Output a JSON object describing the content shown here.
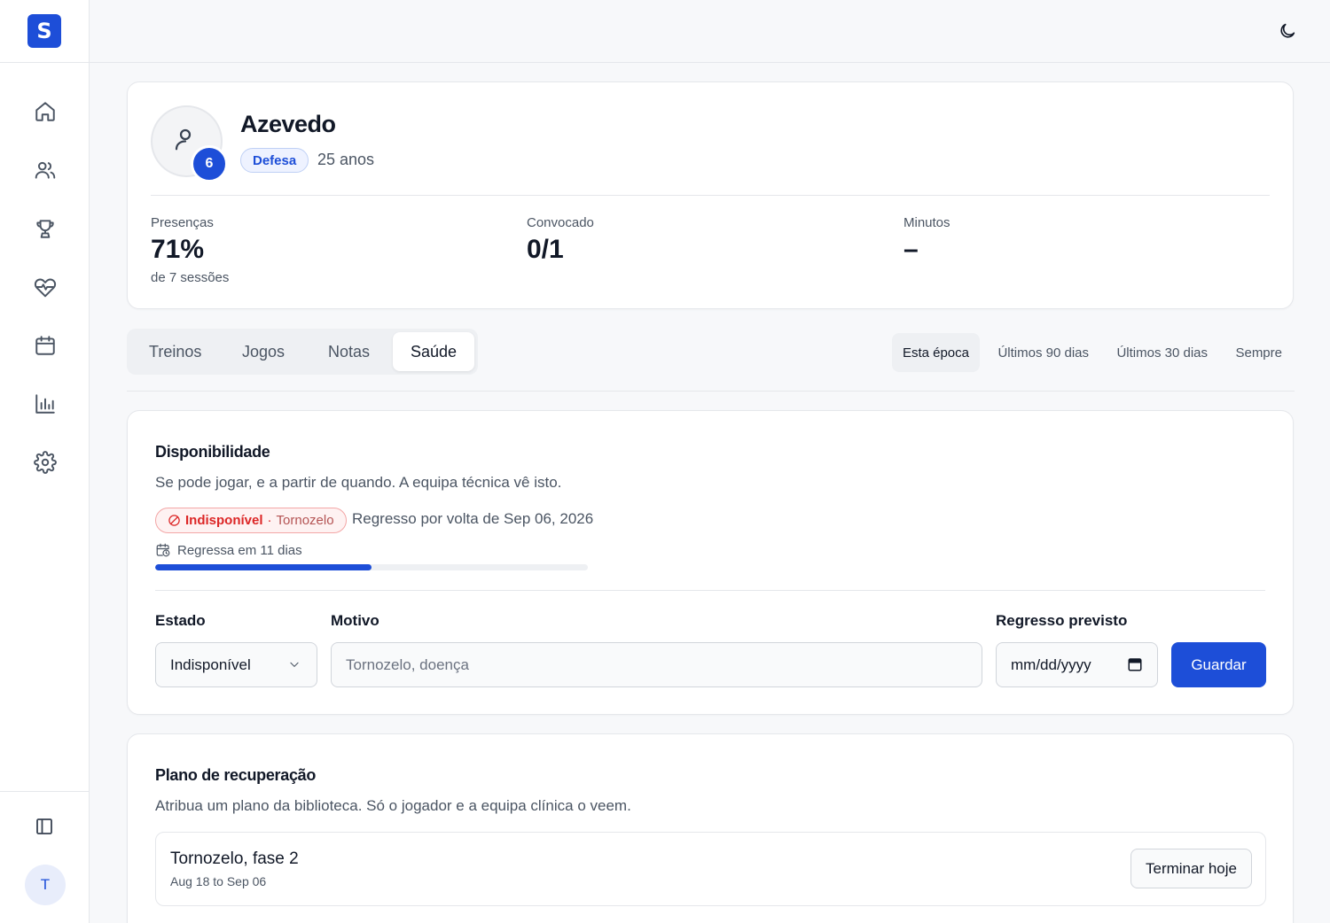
{
  "app": {
    "logo_letter": "S",
    "user_initial": "T"
  },
  "player": {
    "name": "Azevedo",
    "number": "6",
    "position": "Defesa",
    "age": "25 anos"
  },
  "stats": [
    {
      "label": "Presenças",
      "value": "71%",
      "sub": "de 7 sessões"
    },
    {
      "label": "Convocado",
      "value": "0/1",
      "sub": ""
    },
    {
      "label": "Minutos",
      "value": "–",
      "sub": ""
    }
  ],
  "tabs": [
    "Treinos",
    "Jogos",
    "Notas",
    "Saúde"
  ],
  "active_tab": "Saúde",
  "ranges": [
    "Esta época",
    "Últimos 90 dias",
    "Últimos 30 dias",
    "Sempre"
  ],
  "active_range": "Esta época",
  "availability": {
    "title": "Disponibilidade",
    "description": "Se pode jogar, e a partir de quando. A equipa técnica vê isto.",
    "status": "Indisponível",
    "status_separator": "·",
    "status_detail": "Tornozelo",
    "return_text": "Regresso por volta de Sep 06, 2026",
    "countdown": "Regressa em 11 dias",
    "progress_fraction": 0.5,
    "form": {
      "state_label": "Estado",
      "state_value": "Indisponível",
      "reason_label": "Motivo",
      "reason_placeholder": "Tornozelo, doença",
      "return_label": "Regresso previsto",
      "return_placeholder": "mm/dd/yyyy",
      "save_label": "Guardar"
    }
  },
  "recovery": {
    "title": "Plano de recuperação",
    "description": "Atribua um plano da biblioteca. Só o jogador e a equipa clínica o veem.",
    "plan_name": "Tornozelo, fase 2",
    "plan_dates": "Aug 18 to Sep 06",
    "end_label": "Terminar hoje"
  },
  "colors": {
    "accent": "#1d4ed8",
    "danger": "#dc2626"
  }
}
